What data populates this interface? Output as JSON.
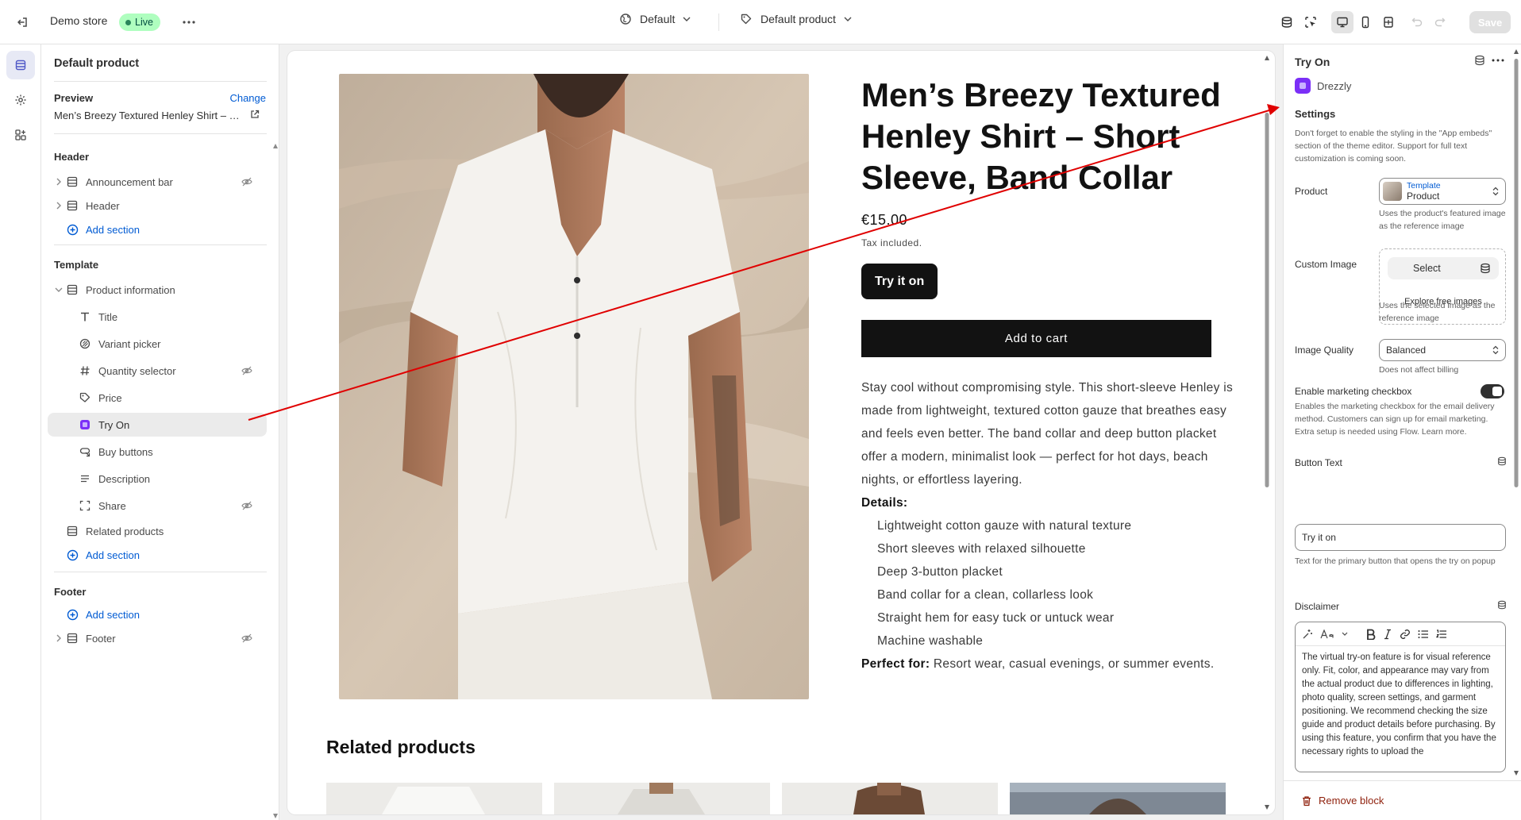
{
  "topbar": {
    "store_name": "Demo store",
    "live_badge": "Live",
    "theme_select": "Default",
    "template_select": "Default product",
    "save_label": "Save"
  },
  "sidebar": {
    "title": "Default product",
    "preview": {
      "label": "Preview",
      "change_label": "Change",
      "product": "Men’s Breezy Textured Henley Shirt – Short Sleeve, Band Collar"
    },
    "header_group": {
      "label": "Header",
      "items": [
        "Announcement bar",
        "Header"
      ],
      "add_section": "Add section"
    },
    "template_group": {
      "label": "Template",
      "section": "Product information",
      "blocks": [
        "Title",
        "Variant picker",
        "Quantity selector",
        "Price",
        "Try On",
        "Buy buttons",
        "Description",
        "Share"
      ],
      "related": "Related products",
      "add_section": "Add section"
    },
    "footer_group": {
      "label": "Footer",
      "add_section": "Add section",
      "items": [
        "Footer"
      ]
    }
  },
  "product": {
    "title": "Men’s Breezy Textured Henley Shirt – Short Sleeve, Band Collar",
    "price": "€15.00",
    "tax_note": "Tax included.",
    "try_on_label": "Try it on",
    "add_to_cart_label": "Add to cart",
    "description": "Stay cool without compromising style. This short-sleeve Henley is made from lightweight, textured cotton gauze that breathes easy and feels even better. The band collar and deep button placket offer a modern, minimalist look — perfect for hot days, beach nights, or effortless layering.",
    "details_label": "Details:",
    "details": [
      "Lightweight cotton gauze with natural texture",
      "Short sleeves with relaxed silhouette",
      "Deep 3-button placket",
      "Band collar for a clean, collarless look",
      "Straight hem for easy tuck or untuck wear",
      "Machine washable"
    ],
    "perfect_label": "Perfect for:",
    "perfect_text": "Resort wear, casual evenings, or summer events.",
    "related_heading": "Related products"
  },
  "settings": {
    "block_title": "Try On",
    "app_name": "Drezzly",
    "section_label": "Settings",
    "intro_help": "Don't forget to enable the styling in the \"App embeds\" section of the theme editor. Support for full text customization is coming soon.",
    "product_label": "Product",
    "product_picker_line1": "Template",
    "product_picker_line2": "Product",
    "product_help": "Uses the product's featured image as the reference image",
    "custom_image_label": "Custom Image",
    "select_label": "Select",
    "explore_label": "Explore free images",
    "custom_image_help": "Uses the selected image as the reference image",
    "quality_label": "Image Quality",
    "quality_value": "Balanced",
    "quality_help": "Does not affect billing",
    "marketing_label": "Enable marketing checkbox",
    "marketing_enabled": true,
    "marketing_help": "Enables the marketing checkbox for the email delivery method. Customers can sign up for email marketing. Extra setup is needed using Flow. Learn more.",
    "button_text_label": "Button Text",
    "button_text_value": "Try it on",
    "button_text_help": "Text for the primary button that opens the try on popup",
    "disclaimer_label": "Disclaimer",
    "disclaimer_text": "The virtual try-on feature is for visual reference only. Fit, color, and appearance may vary from the actual product due to differences in lighting, photo quality, screen settings, and garment positioning. We recommend checking the size guide and product details before purchasing. By using this feature, you confirm that you have the necessary rights to upload the",
    "remove_label": "Remove block"
  },
  "colors": {
    "accent_link": "#005bd3",
    "live_badge_bg": "#affebf",
    "annotation_arrow": "#e00000",
    "app_icon": "#7b2ff7",
    "remove_text": "#8e1f0b"
  }
}
